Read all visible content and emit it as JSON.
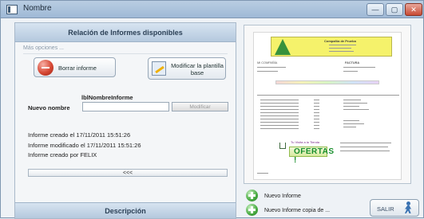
{
  "window": {
    "title": "Nombre",
    "controls": {
      "minimize": "—",
      "maximize": "▢",
      "close": "✕"
    }
  },
  "left_panel": {
    "header": "Relación de Informes disponibles",
    "more_options": "Más opciones ...",
    "delete_button": "Borrar informe",
    "modify_template_button": [
      "Modificar la plantilla",
      "base"
    ],
    "report_name_label": "lblNombreInforme",
    "new_name_label": "Nuevo nombre",
    "new_name_value": "",
    "modify_button": "Modificar",
    "created": "Informe creado el 17/11/2011 15:51:26",
    "modified": "Informe modificado el 17/11/2011 15:51:26",
    "created_by": "Informe creado por FELIX",
    "collapse": "<<<",
    "description_header": "Descripción"
  },
  "preview": {
    "company": "Compañía de Prueba",
    "client_label": "MI COMPAÑÍA",
    "invoice": "FACTURA",
    "ad_title": "Tu Visita a la Tienda",
    "ad_offers": "OFERTAS !"
  },
  "actions": {
    "new_report": "Nuevo Informe",
    "new_report_copy": "Nuevo Informe copia de ...",
    "exit": "SALIR"
  },
  "colors": {
    "accent": "#b5c9de",
    "delete_red": "#d64834",
    "green": "#46a93f",
    "doc_yellow": "#f5f26b"
  }
}
